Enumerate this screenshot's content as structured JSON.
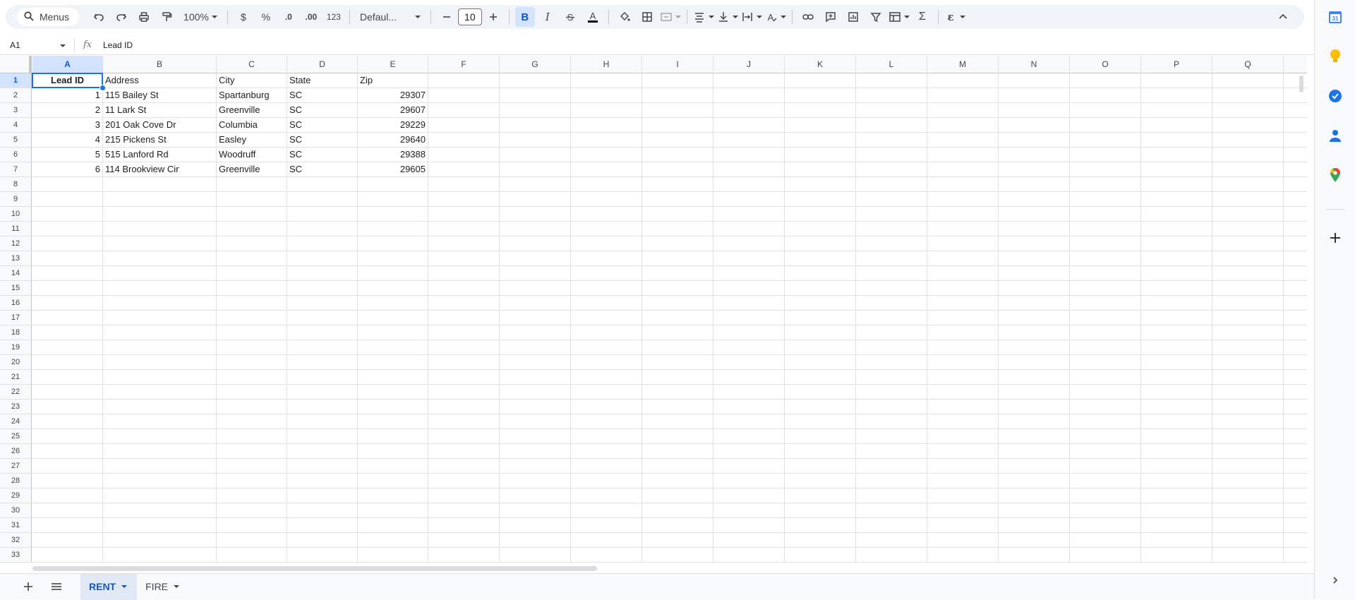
{
  "toolbar": {
    "search_label": "Menus",
    "zoom": "100%",
    "currency": "$",
    "percent": "%",
    "decrease_decimal": ".0",
    "increase_decimal": ".00",
    "number_format": "123",
    "font_name": "Defaul...",
    "font_size": "10",
    "bold": "B",
    "italic": "I",
    "sum": "Σ"
  },
  "formula_bar": {
    "cell_ref": "A1",
    "fx": "fx",
    "content": "Lead ID"
  },
  "columns": [
    "A",
    "B",
    "C",
    "D",
    "E",
    "F",
    "G",
    "H",
    "I",
    "J",
    "K",
    "L",
    "M",
    "N",
    "O",
    "P",
    "Q"
  ],
  "rows": [
    "1",
    "2",
    "3",
    "4",
    "5",
    "6",
    "7",
    "8",
    "9",
    "10",
    "11",
    "12",
    "13",
    "14",
    "15",
    "16",
    "17",
    "18",
    "19",
    "20",
    "21",
    "22",
    "23",
    "24",
    "25",
    "26",
    "27",
    "28",
    "29",
    "30",
    "31",
    "32",
    "33"
  ],
  "table": {
    "headers": [
      "Lead ID",
      "Address",
      "City",
      "State",
      "Zip"
    ],
    "rows": [
      [
        "1",
        "115 Bailey St",
        "Spartanburg",
        "SC",
        "29307"
      ],
      [
        "2",
        "11 Lark St",
        "Greenville",
        "SC",
        "29607"
      ],
      [
        "3",
        "201 Oak Cove Dr",
        "Columbia",
        "SC",
        "29229"
      ],
      [
        "4",
        "215 Pickens St",
        "Easley",
        "SC",
        "29640"
      ],
      [
        "5",
        "515 Lanford Rd",
        "Woodruff",
        "SC",
        "29388"
      ],
      [
        "6",
        "114 Brookview Cir",
        "Greenville",
        "SC",
        "29605"
      ]
    ]
  },
  "selected_cell": "A1",
  "sheets": [
    {
      "name": "RENT",
      "active": true
    },
    {
      "name": "FIRE",
      "active": false
    }
  ],
  "side_panel": {
    "calendar_badge": "31",
    "icons": [
      "calendar-icon",
      "keep-icon",
      "tasks-icon",
      "contacts-icon",
      "maps-icon",
      "add-icon"
    ]
  },
  "colors": {
    "accent": "#1a73e8",
    "selected_header": "#d3e3fd",
    "toolbar_bg": "#f0f4f9"
  }
}
